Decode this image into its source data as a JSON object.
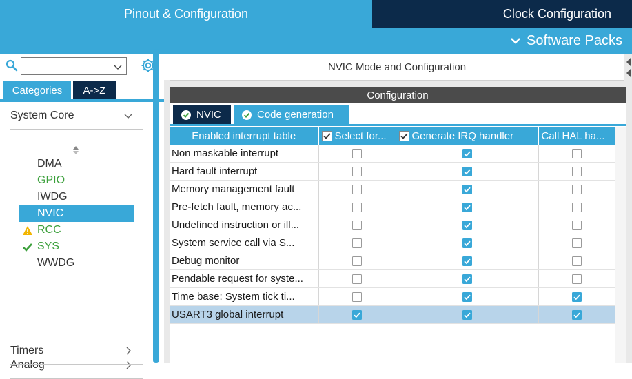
{
  "top_tabs": {
    "pinout": "Pinout & Configuration",
    "clock": "Clock Configuration"
  },
  "subbar": {
    "software_packs": "Software Packs"
  },
  "colors": {
    "accent": "#39a8d8",
    "dark": "#0c2a4a",
    "selected_row": "#b8d4ea",
    "ok_green": "#3ca03c",
    "warn_yellow": "#f2b500"
  },
  "left": {
    "search": {
      "value": ""
    },
    "tabs": {
      "categories": "Categories",
      "az": "A->Z"
    },
    "groups": {
      "system_core": "System Core",
      "analog": "Analog",
      "timers": "Timers"
    },
    "items": [
      {
        "label": "DMA",
        "status": "none",
        "color": "grey"
      },
      {
        "label": "GPIO",
        "status": "none",
        "color": "green"
      },
      {
        "label": "IWDG",
        "status": "none",
        "color": "grey"
      },
      {
        "label": "NVIC",
        "status": "none",
        "color": "selected"
      },
      {
        "label": "RCC",
        "status": "warning",
        "color": "green"
      },
      {
        "label": "SYS",
        "status": "ok",
        "color": "green"
      },
      {
        "label": "WWDG",
        "status": "none",
        "color": "grey"
      }
    ]
  },
  "right": {
    "mode_title": "NVIC Mode and Configuration",
    "config_title": "Configuration",
    "subtabs": {
      "nvic": "NVIC",
      "code": "Code generation"
    },
    "table": {
      "headers": {
        "name": "Enabled interrupt table",
        "select": "Select for...",
        "generate": "Generate IRQ handler",
        "call_hal": "Call HAL ha..."
      },
      "rows": [
        {
          "name": "Non maskable interrupt",
          "select": false,
          "generate": true,
          "hal": false,
          "selected": false
        },
        {
          "name": "Hard fault interrupt",
          "select": false,
          "generate": true,
          "hal": false,
          "selected": false
        },
        {
          "name": "Memory management fault",
          "select": false,
          "generate": true,
          "hal": false,
          "selected": false
        },
        {
          "name": "Pre-fetch fault, memory ac...",
          "select": false,
          "generate": true,
          "hal": false,
          "selected": false
        },
        {
          "name": "Undefined instruction or ill...",
          "select": false,
          "generate": true,
          "hal": false,
          "selected": false
        },
        {
          "name": "System service call via S...",
          "select": false,
          "generate": true,
          "hal": false,
          "selected": false
        },
        {
          "name": "Debug monitor",
          "select": false,
          "generate": true,
          "hal": false,
          "selected": false
        },
        {
          "name": "Pendable request for syste...",
          "select": false,
          "generate": true,
          "hal": false,
          "selected": false
        },
        {
          "name": "Time base: System tick ti...",
          "select": false,
          "generate": true,
          "hal": true,
          "selected": false
        },
        {
          "name": "USART3 global interrupt",
          "select": true,
          "generate": true,
          "hal": true,
          "selected": true
        }
      ]
    }
  }
}
